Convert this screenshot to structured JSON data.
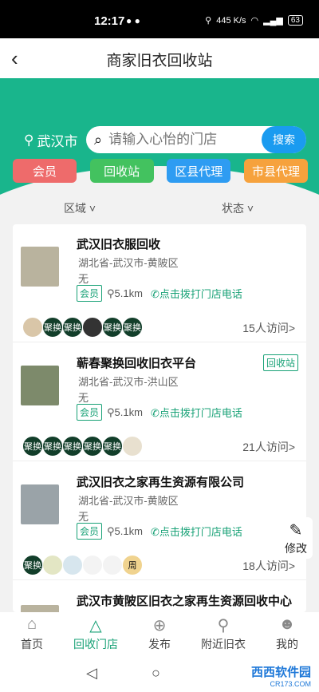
{
  "status_bar": {
    "time": "12:17",
    "net_speed": "445 K/s",
    "battery": "63"
  },
  "nav": {
    "title": "商家旧衣回收站"
  },
  "location": {
    "city": "武汉市"
  },
  "search": {
    "placeholder": "请输入心怡的门店",
    "button": "搜索"
  },
  "categories": [
    {
      "label": "会员",
      "color": "#ee6b6b"
    },
    {
      "label": "回收站",
      "color": "#43c25f"
    },
    {
      "label": "区县代理",
      "color": "#2e9cf2"
    },
    {
      "label": "市县代理",
      "color": "#f6a23d"
    }
  ],
  "filters": {
    "region": "区域",
    "status": "状态"
  },
  "stores": [
    {
      "name": "武汉旧衣服回收",
      "tag": "",
      "address": "湖北省-武汉市-黄陂区",
      "extra": "无",
      "member": "会员",
      "distance": "5.1km",
      "call": "点击拨打门店电话",
      "visits": "15人访问>",
      "avatars": [
        "",
        "聚换",
        "聚换",
        "",
        "聚换",
        "聚换"
      ]
    },
    {
      "name": "蕲春聚换回收旧衣平台",
      "tag": "回收站",
      "address": "湖北省-武汉市-洪山区",
      "extra": "无",
      "member": "会员",
      "distance": "5.1km",
      "call": "点击拨打门店电话",
      "visits": "21人访问>",
      "avatars": [
        "聚换",
        "聚换",
        "聚换",
        "聚换",
        "聚换",
        ""
      ]
    },
    {
      "name": "武汉旧衣之家再生资源有限公司",
      "tag": "",
      "address": "湖北省-武汉市-黄陂区",
      "extra": "无",
      "member": "会员",
      "distance": "5.1km",
      "call": "点击拨打门店电话",
      "visits": "18人访问>",
      "avatars": [
        "聚换",
        "",
        "",
        "",
        "",
        "周"
      ]
    },
    {
      "name": "武汉市黄陂区旧衣之家再生资源回收中心",
      "tag": "",
      "address": "",
      "extra": "",
      "member": "",
      "distance": "",
      "call": "",
      "visits": "",
      "avatars": []
    }
  ],
  "edit_button": "修改",
  "tabs": [
    {
      "label": "首页",
      "icon": "home-icon",
      "active": false
    },
    {
      "label": "回收门店",
      "icon": "recycle-icon",
      "active": true
    },
    {
      "label": "发布",
      "icon": "plus-icon",
      "active": false
    },
    {
      "label": "附近旧衣",
      "icon": "location-icon",
      "active": false
    },
    {
      "label": "我的",
      "icon": "user-icon",
      "active": false
    }
  ],
  "watermark": {
    "text": "西西软件园",
    "sub": "CR173.COM"
  },
  "colors": {
    "primary": "#19b58c",
    "accent_green": "#19a277",
    "search_button": "#1a9bf0"
  }
}
